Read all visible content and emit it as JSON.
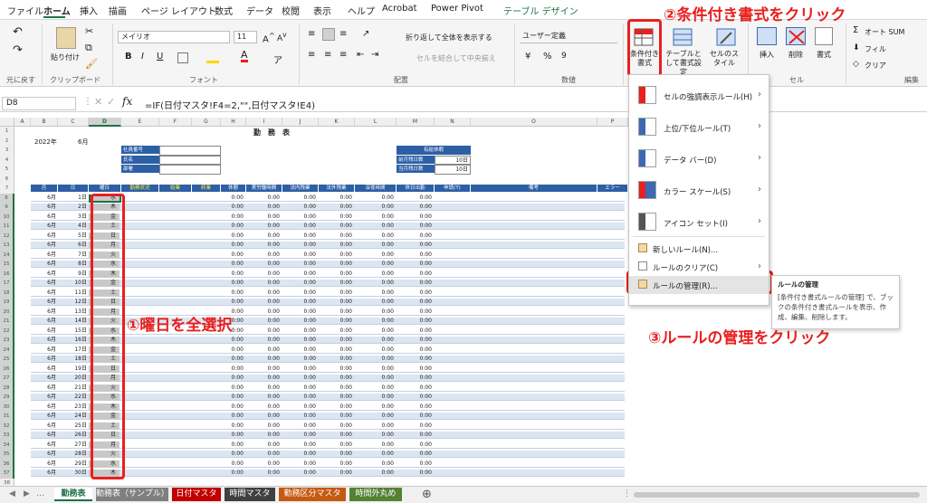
{
  "menu": {
    "tabs": [
      "ファイル",
      "ホーム",
      "挿入",
      "描画",
      "ページ レイアウト",
      "数式",
      "データ",
      "校閲",
      "表示",
      "ヘルプ",
      "Acrobat",
      "Power Pivot",
      "テーブル デザイン"
    ]
  },
  "ribbon": {
    "undo_group": "元に戻す",
    "clipboard_group": "クリップボード",
    "paste_label": "貼り付け",
    "font_group": "フォント",
    "font_name": "メイリオ",
    "font_size": "11",
    "align_group": "配置",
    "wrap_text": "折り返して全体を表示する",
    "merge_center": "セルを結合して中央揃え",
    "number_group": "数値",
    "number_format": "ユーザー定義",
    "cond_format": "条件付き書式",
    "table_format": "テーブルとして書式設定",
    "cell_style": "セルのスタイル",
    "insert": "挿入",
    "delete": "削除",
    "format": "書式",
    "cells_group": "セル",
    "autosum": "オート SUM",
    "fill": "フィル",
    "clear": "クリア",
    "edit_group": "編集"
  },
  "formula_bar": {
    "name_box": "D8",
    "formula": "=IF(日付マスタ!F4=2,\"\",日付マスタ!E4)"
  },
  "sheet": {
    "columns": [
      "A",
      "B",
      "C",
      "D",
      "E",
      "F",
      "G",
      "H",
      "I",
      "J",
      "K",
      "L",
      "M",
      "N",
      "O",
      "P"
    ],
    "row_numbers": [
      "1",
      "2",
      "3",
      "4",
      "5",
      "6",
      "7",
      "8",
      "9",
      "10",
      "11",
      "12",
      "13",
      "14",
      "15",
      "16",
      "17",
      "18",
      "19",
      "20",
      "21",
      "22",
      "23",
      "24",
      "25",
      "26",
      "27",
      "28",
      "29",
      "30",
      "31",
      "32",
      "33",
      "34",
      "35",
      "36",
      "37",
      "38"
    ],
    "title": "勤　務　表",
    "year": "2022年",
    "month_label": "6月",
    "info_labels": [
      "社員番号",
      "氏名",
      "部署"
    ],
    "leave_title": "有給休暇",
    "leave_rows": [
      {
        "label": "前月残日数",
        "value": "10日"
      },
      {
        "label": "当月残日数",
        "value": "10日"
      }
    ],
    "headers": [
      "月",
      "日",
      "曜日",
      "勤務状況",
      "始業",
      "終業",
      "休憩",
      "実労働時間",
      "法内残業",
      "法外残業",
      "深夜時間",
      "休日出勤",
      "申請(T)",
      "備考",
      "エラー"
    ],
    "month": "6月",
    "days": [
      "1日",
      "2日",
      "3日",
      "4日",
      "5日",
      "6日",
      "7日",
      "8日",
      "9日",
      "10日",
      "11日",
      "12日",
      "13日",
      "14日",
      "15日",
      "16日",
      "17日",
      "18日",
      "19日",
      "20日",
      "21日",
      "22日",
      "23日",
      "24日",
      "25日",
      "26日",
      "27日",
      "28日",
      "29日",
      "30日"
    ],
    "weekdays": [
      "水",
      "木",
      "金",
      "土",
      "日",
      "月",
      "火",
      "水",
      "木",
      "金",
      "土",
      "日",
      "月",
      "火",
      "水",
      "木",
      "金",
      "土",
      "日",
      "月",
      "火",
      "水",
      "木",
      "金",
      "土",
      "日",
      "月",
      "火",
      "水",
      "木"
    ],
    "zero_time": "0:00"
  },
  "cf_menu": {
    "items": [
      {
        "label": "セルの強調表示ルール(H)",
        "arrow": true
      },
      {
        "label": "上位/下位ルール(T)",
        "arrow": true
      },
      {
        "label": "データ バー(D)",
        "arrow": true
      },
      {
        "label": "カラー スケール(S)",
        "arrow": true
      },
      {
        "label": "アイコン セット(I)",
        "arrow": true
      }
    ],
    "new_rule": "新しいルール(N)...",
    "clear_rules": "ルールのクリア(C)",
    "manage_rules": "ルールの管理(R)..."
  },
  "tooltip": {
    "title": "ルールの管理",
    "body": "[条件付き書式ルールの管理] で、ブックの条件付き書式ルールを表示、作成、編集、削除します。"
  },
  "annotations": {
    "step1": "①曜日を全選択",
    "step2": "②条件付き書式をクリック",
    "step3": "③ルールの管理をクリック"
  },
  "sheet_tabs": [
    {
      "label": "勤務表",
      "color": "#ffffff",
      "active": true
    },
    {
      "label": "勤務表（サンプル）",
      "color": "#7f7f7f"
    },
    {
      "label": "日付マスタ",
      "color": "#c00000"
    },
    {
      "label": "時間マスタ",
      "color": "#404040"
    },
    {
      "label": "勤務区分マスタ",
      "color": "#c55a11"
    },
    {
      "label": "時間外丸め",
      "color": "#548235"
    }
  ],
  "colors": {
    "accent": "#1e7145",
    "annotation": "#e8201e",
    "header_blue": "#2d5fa5",
    "stripe": "#dce6f2"
  }
}
